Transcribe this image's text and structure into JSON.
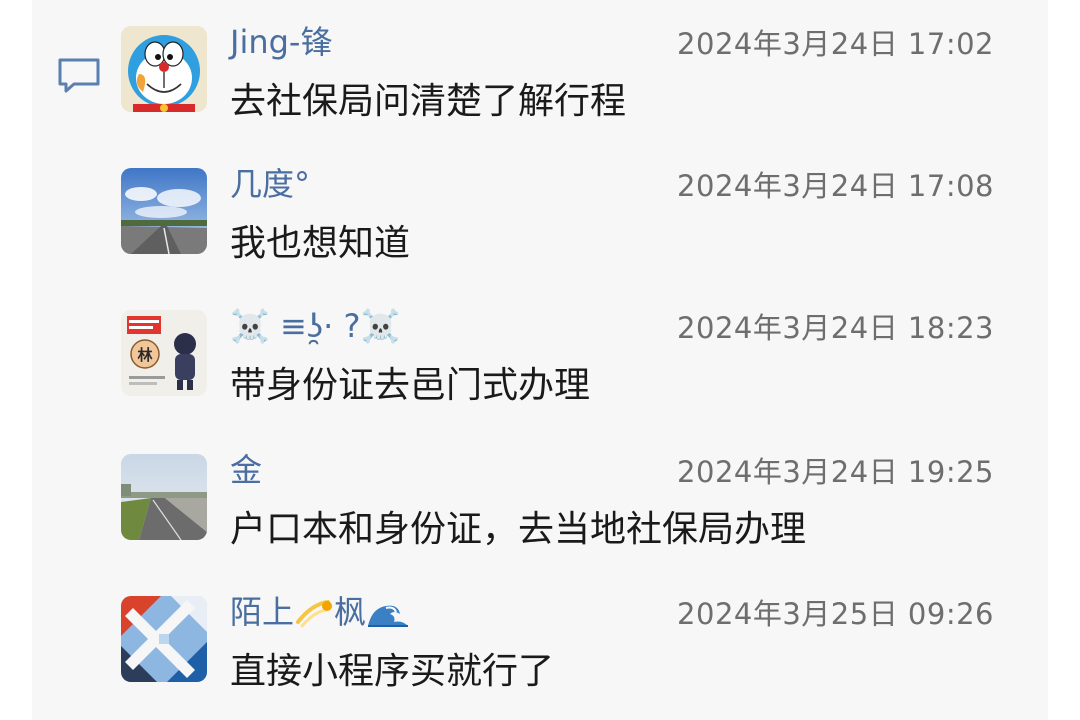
{
  "icons": {
    "comment": "comment-bubble-icon"
  },
  "colors": {
    "panel_bg": "#f7f7f7",
    "name": "#4a6ea0",
    "time": "#6e6e6e",
    "message": "#1a1a1a"
  },
  "comments": [
    {
      "name": "Jing-锋",
      "time": "2024年3月24日 17:02",
      "message": "去社保局问清楚了解行程",
      "avatar": "doraemon-avatar"
    },
    {
      "name": "几度°",
      "time": "2024年3月24日 17:08",
      "message": "我也想知道",
      "avatar": "sky-road-avatar"
    },
    {
      "name": "☠️ ≡ʖ̯· ?☠️",
      "time": "2024年3月24日 18:23",
      "message": "带身份证去邑门式办理",
      "avatar": "lin-sticker-avatar"
    },
    {
      "name": "金",
      "time": "2024年3月24日 19:25",
      "message": "户口本和身份证，去当地社保局办理",
      "avatar": "road-avatar"
    },
    {
      "name": "陌上",
      "name_suffix": "枫",
      "time": "2024年3月25日 09:26",
      "message": "直接小程序买就行了",
      "avatar": "geometric-avatar"
    }
  ]
}
